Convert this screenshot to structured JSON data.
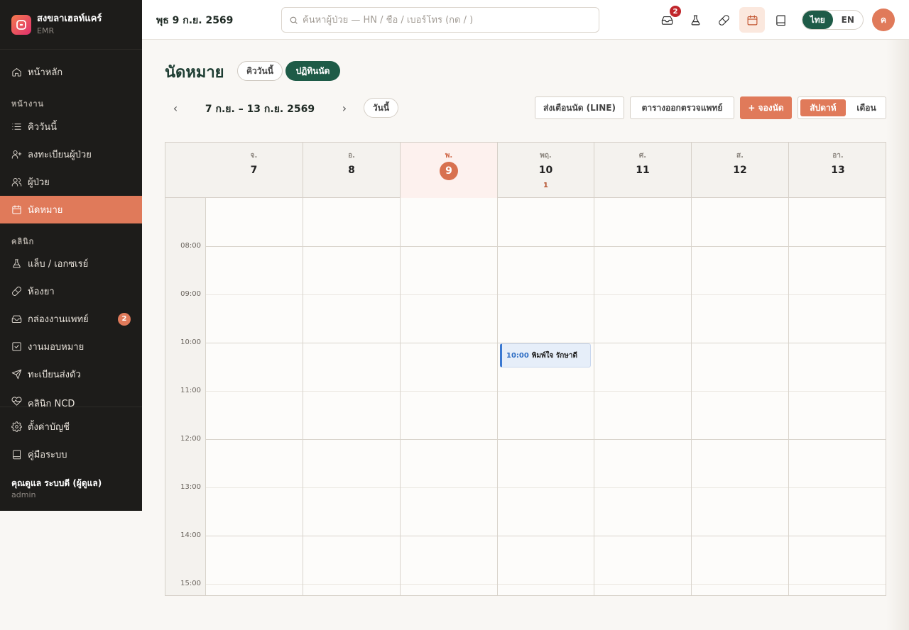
{
  "brand": {
    "name": "สงขลาเฮลท์แคร์",
    "sub": "EMR"
  },
  "sidebar": {
    "home": "หน้าหลัก",
    "section_work": "หน้างาน",
    "queue": "คิววันนี้",
    "register": "ลงทะเบียนผู้ป่วย",
    "patients": "ผู้ป่วย",
    "appointments": "นัดหมาย",
    "section_clinic": "คลินิก",
    "lab": "แล็บ / เอกซเรย์",
    "pharmacy": "ห้องยา",
    "inbox": "กล่องงานแพทย์",
    "inbox_count": "2",
    "assignments": "งานมอบหมาย",
    "referral": "ทะเบียนส่งตัว",
    "ncd": "คลินิก NCD",
    "settings": "ตั้งค่าบัญชี",
    "manual": "คู่มือระบบ",
    "user_name": "คุณดูแล ระบบดี (ผู้ดูแล)",
    "user_role": "admin"
  },
  "topbar": {
    "date": "พุธ 9 ก.ย. 2569",
    "search_placeholder": "ค้นหาผู้ป่วย — HN / ชื่อ / เบอร์โทร (กด / )",
    "inbox_badge": "2",
    "lang_th": "ไทย",
    "lang_en": "EN",
    "avatar": "ค"
  },
  "page": {
    "title": "นัดหมาย",
    "tab_queue": "คิววันนี้",
    "tab_calendar": "ปฏิทินนัด",
    "prev": "‹",
    "next": "›",
    "range": "7 ก.ย. – 13 ก.ย. 2569",
    "today_btn": "วันนี้",
    "remind_btn": "ส่งเตือนนัด (LINE)",
    "doctor_btn": "ตารางออกตรวจแพทย์",
    "book_btn": "+ จองนัด",
    "view_week": "สัปดาห์",
    "view_month": "เดือน"
  },
  "calendar": {
    "days": [
      {
        "dow": "จ.",
        "num": "7",
        "count": ""
      },
      {
        "dow": "อ.",
        "num": "8",
        "count": ""
      },
      {
        "dow": "พ.",
        "num": "9",
        "count": ""
      },
      {
        "dow": "พฤ.",
        "num": "10",
        "count": "1"
      },
      {
        "dow": "ศ.",
        "num": "11",
        "count": ""
      },
      {
        "dow": "ส.",
        "num": "12",
        "count": ""
      },
      {
        "dow": "อา.",
        "num": "13",
        "count": ""
      }
    ],
    "times": [
      "08:00",
      "09:00",
      "10:00",
      "11:00",
      "12:00",
      "13:00",
      "14:00",
      "15:00"
    ],
    "event": {
      "time": "10:00",
      "name": "พิมพ์ใจ รักษาดี"
    }
  }
}
